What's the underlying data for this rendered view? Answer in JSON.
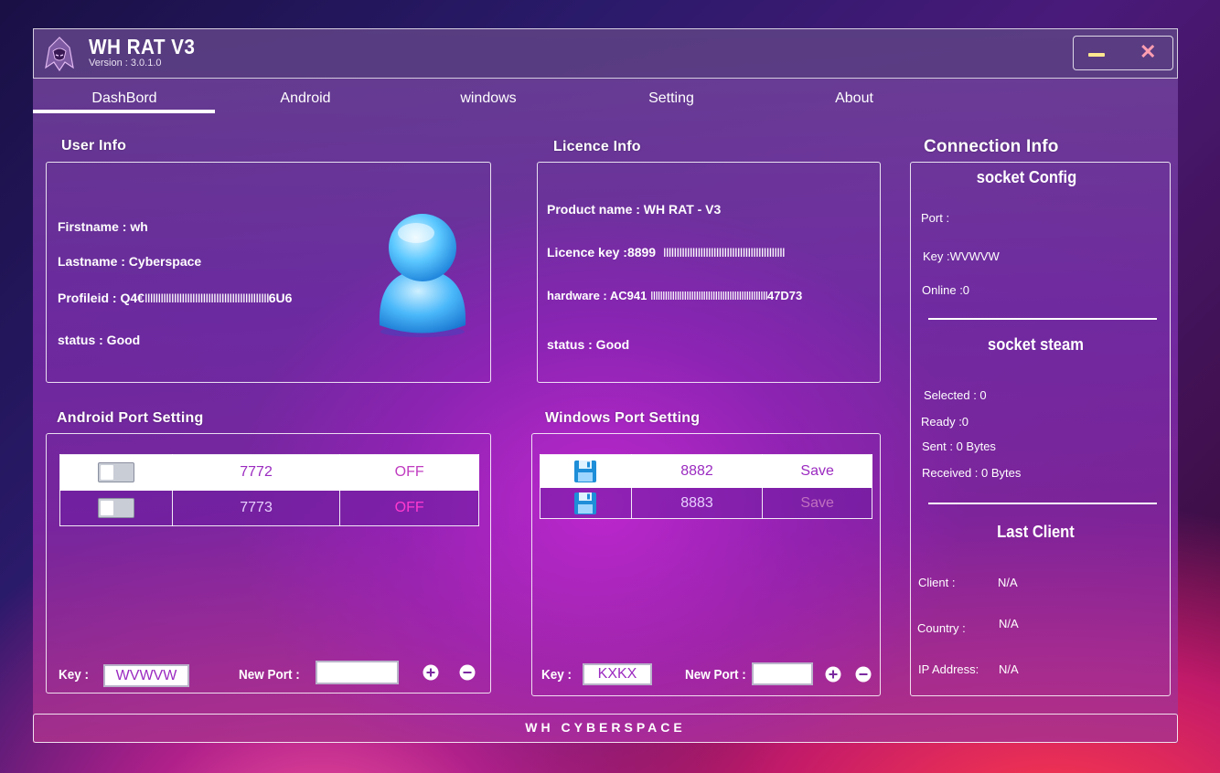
{
  "app": {
    "title": "WH RAT V3",
    "version": "Version : 3.0.1.0"
  },
  "tabs": [
    "DashBord",
    "Android",
    "windows",
    "Setting",
    "About"
  ],
  "user_info": {
    "title": "User Info",
    "firstname": "Firstname  : wh",
    "lastname": "Lastname : Cyberspace",
    "profile_prefix": "Profileid : Q4€",
    "profile_bars": "IIIIIIIIIIIIIIIIIIIIIIIIIIIIIIIIIIIIIIIIIIIIIII",
    "profile_suffix": "6U6",
    "status": "status : Good"
  },
  "licence_info": {
    "title": "Licence Info",
    "product": "Product name : WH RAT - V3",
    "licence_prefix": "Licence key :8899",
    "licence_bars": "IIIIIIIIIIIIIIIIIIIIIIIIIIIIIIIIIIIIIIIIIIIIII",
    "hardware_prefix": "hardware : AC941",
    "hardware_bars": "IIIIIIIIIIIIIIIIIIIIIIIIIIIIIIIIIIIIIIIIIIIIIIIII",
    "hardware_suffix": "47D73",
    "status": "status : Good"
  },
  "android_ports": {
    "title": "Android Port Setting",
    "rows": [
      {
        "port": "7772",
        "state": "OFF"
      },
      {
        "port": "7773",
        "state": "OFF"
      }
    ],
    "key_label": "Key :",
    "key_value": "WVWVW",
    "new_port_label": "New Port :",
    "new_port_value": ""
  },
  "windows_ports": {
    "title": "Windows Port Setting",
    "rows": [
      {
        "port": "8882",
        "action": "Save"
      },
      {
        "port": "8883",
        "action": "Save"
      }
    ],
    "key_label": "Key :",
    "key_value": "KXKX",
    "new_port_label": "New Port :",
    "new_port_value": ""
  },
  "connection_info": {
    "title": "Connection Info",
    "socket_config": {
      "title": "socket Config",
      "port": "Port :",
      "key": "Key :WVWVW",
      "online": "Online :0"
    },
    "socket_steam": {
      "title": "socket steam",
      "selected": "Selected : 0",
      "ready": "Ready :0",
      "sent": "Sent : 0 Bytes",
      "received": "Received : 0 Bytes"
    },
    "last_client": {
      "title": "Last Client",
      "client_label": "Client :",
      "client_value": "N/A",
      "country_label": "Country :",
      "country_value": "N/A",
      "ip_label": "IP Address:",
      "ip_value": "N/A"
    }
  },
  "footer": "WH CYBERSPACE",
  "colors": {
    "accent_text": "#9b2bc0",
    "off_text": "#e040c0",
    "minimize": "#ffe890",
    "close": "#ff9fb0"
  }
}
